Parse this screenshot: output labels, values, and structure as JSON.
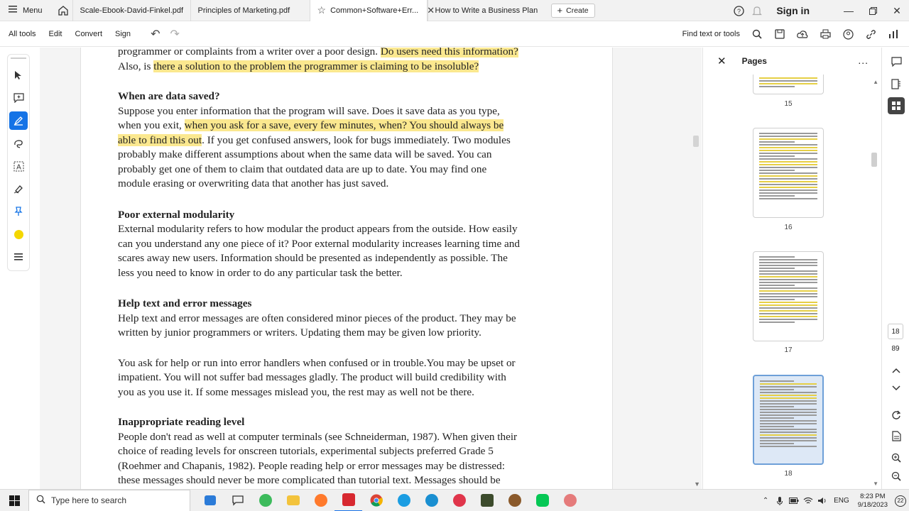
{
  "tabbar": {
    "menu_label": "Menu",
    "tabs": [
      {
        "label": "Scale-Ebook-David-Finkel.pdf"
      },
      {
        "label": "Principles of Marketing.pdf"
      },
      {
        "label": "Common+Software+Err..."
      },
      {
        "label": "How to Write a Business Plan"
      }
    ],
    "create_label": "Create",
    "signin_label": "Sign in"
  },
  "toolbar": {
    "items": [
      "All tools",
      "Edit",
      "Convert",
      "Sign"
    ],
    "find_label": "Find text or tools"
  },
  "document": {
    "para1_line1_a": "programmer or complaints from a writer over a poor design. ",
    "para1_line1_hl": "Do users need this information?",
    "para1_line2_a": "Also, is ",
    "para1_line2_hl": "there a solution to the problem the programmer is claiming to be insoluble?",
    "h_data_saved": "When are data saved?",
    "ds_line1": "Suppose you enter information that the program will save. Does it save data as you type,",
    "ds_line2_a": "when you exit, ",
    "ds_line2_hl": "when you ask for a save, every few minutes, when? You should always be",
    "ds_line3_hl": "able to find this out",
    "ds_line3_b": ". If you get confused answers, look for bugs immediately. Two modules",
    "ds_line4": "probably make different assumptions about when the same data will be saved. You can",
    "ds_line5": "probably get one of them to claim that outdated data are up to date. You may find one",
    "ds_line6": "module erasing or overwriting data that another has just saved.",
    "h_modularity": "Poor external modularity",
    "mod_line1": "External modularity refers to how modular the product appears from the outside. How easily",
    "mod_line2": "can you understand any one piece of it? Poor external modularity increases learning time and",
    "mod_line3": "scares away new users. Information should be presented as independently as possible. The",
    "mod_line4": "less you need to know in order to do any particular task the better.",
    "h_help": "Help text and error messages",
    "help_line1": "Help text and error messages are often considered minor pieces of the product. They may be",
    "help_line2": "written by junior programmers or writers. Updating them may be given low priority.",
    "help2_line1": "You ask for help or run into error handlers when confused or in trouble.You may be upset or",
    "help2_line2": "impatient. You will not suffer bad messages gladly. The product will build credibility with",
    "help2_line3": "you as you use it. If some messages mislead you, the rest may as well not be there.",
    "h_reading": "Inappropriate reading level",
    "rd_line1": "People don't read as well at computer terminals (see Schneiderman, 1987). When given their",
    "rd_line2": "choice of reading levels for onscreen tutorials, experimental subjects preferred Grade 5",
    "rd_line3": "(Roehmer and Chapanis, 1982). People reading help or error messages may be distressed:",
    "rd_line4": "these messages should never be more complicated than tutorial text. Messages should be"
  },
  "pages_panel": {
    "title": "Pages",
    "more": "...",
    "thumb_numbers": [
      "15",
      "16",
      "17",
      "18"
    ],
    "current_page": "18",
    "total_pages": "89"
  },
  "taskbar": {
    "search_placeholder": "Type here to search",
    "lang": "ENG",
    "time": "8:23 PM",
    "date": "9/18/2023",
    "notif_count": "22"
  },
  "colors": {
    "highlight": "#fbe88f",
    "accent": "#1473e6",
    "acrobat_red": "#d7282f"
  }
}
